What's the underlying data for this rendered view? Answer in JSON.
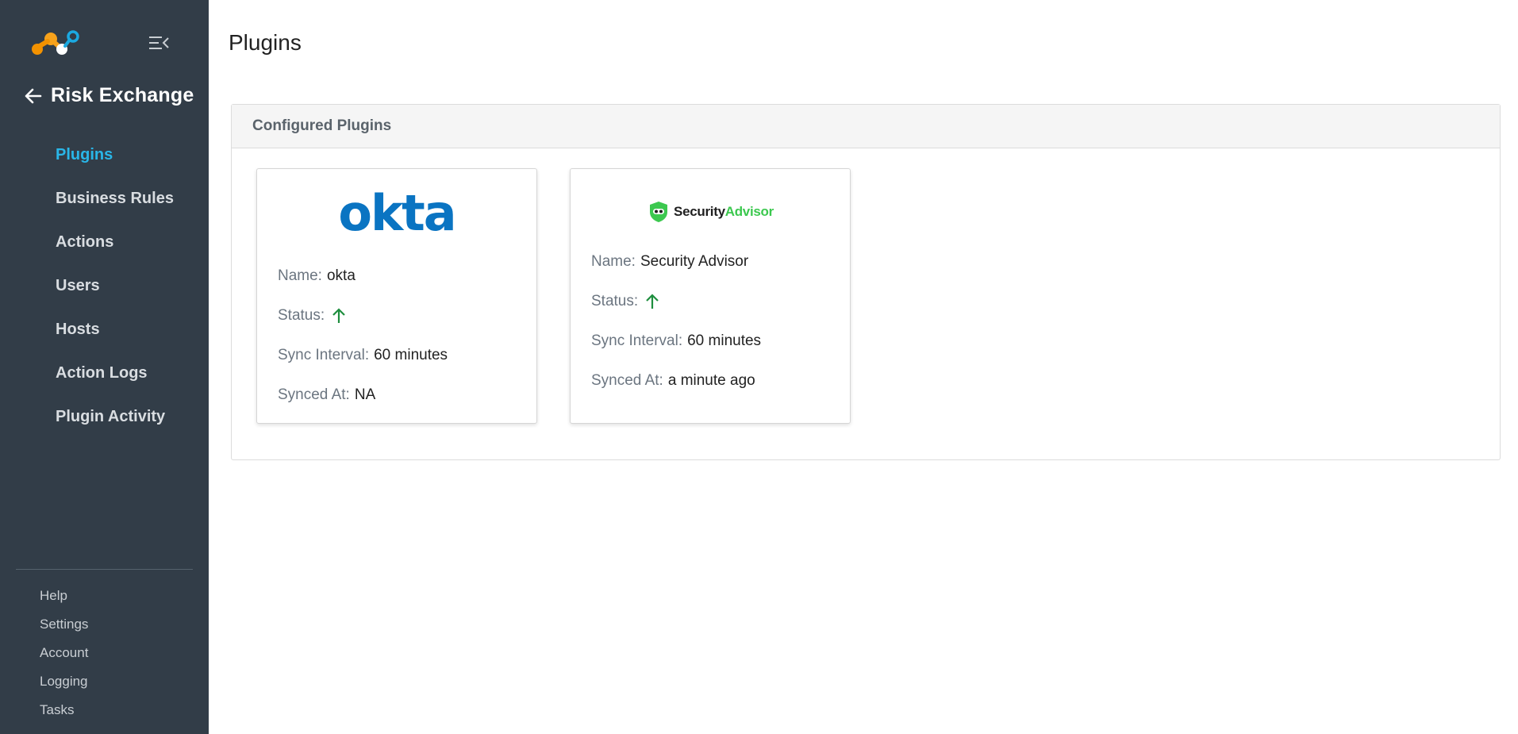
{
  "app": {
    "section_title": "Risk Exchange"
  },
  "sidebar": {
    "items": [
      {
        "label": "Plugins",
        "active": true
      },
      {
        "label": "Business Rules"
      },
      {
        "label": "Actions"
      },
      {
        "label": "Users"
      },
      {
        "label": "Hosts"
      },
      {
        "label": "Action Logs"
      },
      {
        "label": "Plugin Activity"
      }
    ],
    "bottom_items": [
      {
        "label": "Help"
      },
      {
        "label": "Settings"
      },
      {
        "label": "Account"
      },
      {
        "label": "Logging"
      },
      {
        "label": "Tasks"
      }
    ]
  },
  "page": {
    "title": "Plugins",
    "panel_title": "Configured Plugins"
  },
  "plugins": [
    {
      "logo_text": "okta",
      "name_label": "Name:",
      "name": "okta",
      "status_label": "Status:",
      "status": "up",
      "sync_label": "Sync Interval:",
      "sync_interval": "60 minutes",
      "synced_label": "Synced At:",
      "synced_at": "NA"
    },
    {
      "logo_text_a": "Security",
      "logo_text_b": "Advisor",
      "name_label": "Name:",
      "name": "Security Advisor",
      "status_label": "Status:",
      "status": "up",
      "sync_label": "Sync Interval:",
      "sync_interval": "60 minutes",
      "synced_label": "Synced At:",
      "synced_at": "a minute ago"
    }
  ],
  "colors": {
    "sidebar_bg": "#323d48",
    "active_nav": "#29b6e8",
    "status_up": "#1e8e3e",
    "okta_blue": "#0a74c2",
    "security_advisor_green": "#3cc84f"
  }
}
